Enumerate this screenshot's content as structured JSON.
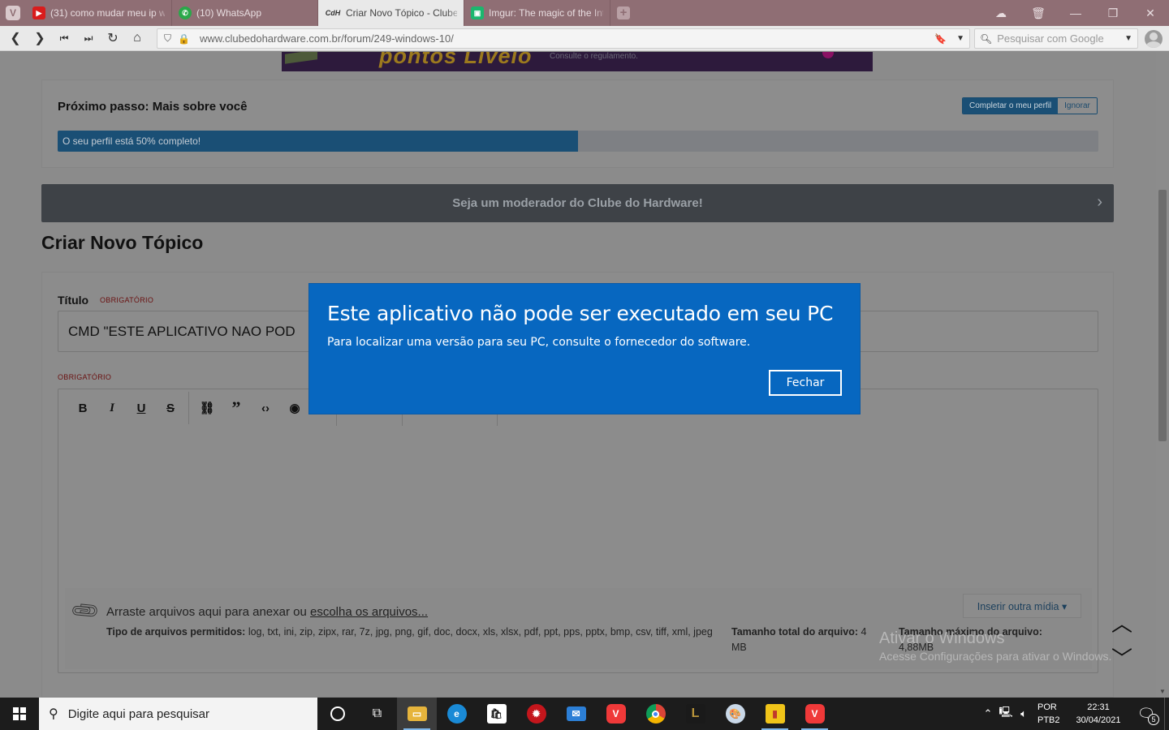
{
  "browser": {
    "tabs": [
      {
        "label": "(31) como mudar meu ip w",
        "icon": "youtube-icon",
        "icon_color": "#d91c1c",
        "active": false
      },
      {
        "label": "(10) WhatsApp",
        "icon": "whatsapp-icon",
        "icon_color": "#2aa84a",
        "active": false
      },
      {
        "label": "Criar Novo Tópico - Clube d",
        "icon": "clube-do-hardware-icon",
        "icon_color": "#333333",
        "icon_text": "CdH",
        "active": true
      },
      {
        "label": "Imgur: The magic of the Int",
        "icon": "imgur-icon",
        "icon_color": "#1bb76e",
        "active": false
      }
    ],
    "url": "www.clubedohardware.com.br/forum/249-windows-10/",
    "search_placeholder": "Pesquisar com Google"
  },
  "banner_ad": {
    "headline": "pontos Livelo",
    "note": "Consulte o regulamento."
  },
  "next_step": {
    "title": "Próximo passo: Mais sobre você",
    "complete_label": "Completar o meu perfil",
    "ignore_label": "Ignorar",
    "progress_text": "O seu perfil está 50% completo!",
    "progress_fraction": 0.5
  },
  "moderator_bar": {
    "text": "Seja um moderador do Clube do Hardware!"
  },
  "page_title": "Criar Novo Tópico",
  "form": {
    "title_label": "Título",
    "required_label": "OBRIGATÓRIO",
    "title_value": "CMD \"ESTE APLICATIVO NAO POD",
    "content_required_label": "OBRIGATÓRIO",
    "toolbar": [
      "B",
      "I",
      "U",
      "S",
      "link",
      "quote",
      "code",
      "preview"
    ],
    "attach": {
      "drop_text": "Arraste arquivos aqui para anexar ou ",
      "drop_link": "escolha os arquivos...",
      "allowed_label": "Tipo de arquivos permitidos:",
      "allowed_value": "log, txt, ini, zip, zipx, rar, 7z, jpg, png, gif, doc, docx, xls, xlsx, pdf, ppt, pps, pptx, bmp, csv, tiff, xml, jpeg",
      "total_label": "Tamanho total do arquivo:",
      "total_value": "4 MB",
      "max_label": "Tamanho máximo do arquivo:",
      "max_value": "4,88MB",
      "insert_media_label": "Inserir outra mídia ▾"
    }
  },
  "watermark": {
    "title": "Ativar o Windows",
    "subtitle": "Acesse Configurações para ativar o Windows."
  },
  "dialog": {
    "title": "Este aplicativo não pode ser executado em seu PC",
    "message": "Para localizar uma versão para seu PC, consulte o fornecedor do software.",
    "close_label": "Fechar",
    "background": "#0767c0"
  },
  "taskbar": {
    "search_placeholder": "Digite aqui para pesquisar",
    "apps": [
      {
        "name": "cortana-icon",
        "color": "transparent"
      },
      {
        "name": "task-view-icon",
        "color": "transparent"
      },
      {
        "name": "file-explorer-icon",
        "color": "#e6b43c"
      },
      {
        "name": "edge-icon",
        "color": "#1a8ad6"
      },
      {
        "name": "store-icon",
        "color": "#ffffff"
      },
      {
        "name": "antivirus-icon",
        "color": "#c4161c"
      },
      {
        "name": "mail-icon",
        "color": "#2c7fd6"
      },
      {
        "name": "vivaldi-icon",
        "color": "#ef3939"
      },
      {
        "name": "chrome-icon",
        "color": "#2f9e44"
      },
      {
        "name": "league-of-legends-icon",
        "color": "#b8943a"
      },
      {
        "name": "paint-icon",
        "color": "#c9d8e8"
      },
      {
        "name": "sticky-app-icon",
        "color": "#f0c419"
      },
      {
        "name": "vivaldi-icon-2",
        "color": "#ef3939"
      }
    ],
    "lang_top": "POR",
    "lang_bottom": "PTB2",
    "time": "22:31",
    "date": "30/04/2021",
    "notification_count": "5"
  }
}
